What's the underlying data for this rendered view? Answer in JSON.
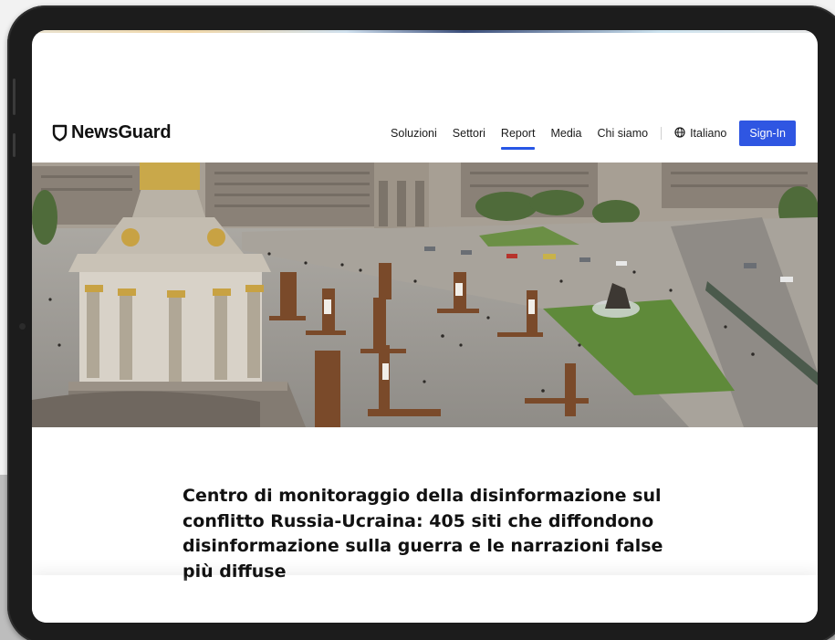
{
  "site": {
    "logo_text": "NewsGuard"
  },
  "nav": {
    "items": [
      {
        "label": "Soluzioni",
        "active": false
      },
      {
        "label": "Settori",
        "active": false
      },
      {
        "label": "Report",
        "active": true
      },
      {
        "label": "Media",
        "active": false
      },
      {
        "label": "Chi siamo",
        "active": false
      }
    ],
    "language_label": "Italiano",
    "signin_label": "Sign-In"
  },
  "colors": {
    "accent": "#2f56e2",
    "active_underline": "#2756e6",
    "text": "#111111"
  },
  "hero": {
    "icon": "kyiv-maidan-square-photo"
  },
  "article": {
    "title": "Centro di monitoraggio della disinformazione sul conflitto Russia-Ucraina: 405 siti che diffondono disinformazione sulla guerra e le narrazioni false più diffuse"
  }
}
